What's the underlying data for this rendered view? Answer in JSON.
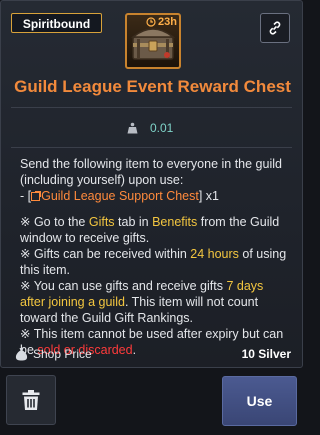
{
  "header": {
    "badge": "Spiritbound",
    "timer": "23h",
    "title": "Guild League Event Reward Chest"
  },
  "stats": {
    "weight": "0.01"
  },
  "description": {
    "intro_line1": "Send the following item to everyone in the guild (including yourself) upon use:",
    "link_prefix": "- [",
    "link_item": "Guild League Support Chest",
    "link_suffix": "] x1",
    "b1_pre": "※ Go to the ",
    "b1_gifts": "Gifts",
    "b1_mid": " tab in ",
    "b1_benefits": "Benefits",
    "b1_post": " from the Guild window to receive gifts.",
    "b2_pre": "※ Gifts can be received within ",
    "b2_hl": "24 hours",
    "b2_post": " of using this item.",
    "b3_pre": "※ You can use gifts and receive gifts ",
    "b3_hl": "7 days after joining a guild",
    "b3_post": ". This item will not count toward the Guild Gift Rankings.",
    "b4_pre": "※ This item cannot be used after expiry but can be ",
    "b4_hl": "sold or discarded",
    "b4_post": "."
  },
  "price": {
    "label": "Shop Price",
    "value": "10 Silver"
  },
  "actions": {
    "use_label": "Use"
  },
  "colors": {
    "title": "#f28a3c",
    "badge_border": "#d8a23a",
    "highlight": "#f3c640",
    "warning": "#ff3b3b",
    "use_button": "#4b5a91"
  },
  "icons": {
    "link": "chain-link-icon",
    "timer": "clock-icon",
    "weight": "weight-icon",
    "price": "money-bag-icon",
    "delete": "trash-icon"
  }
}
